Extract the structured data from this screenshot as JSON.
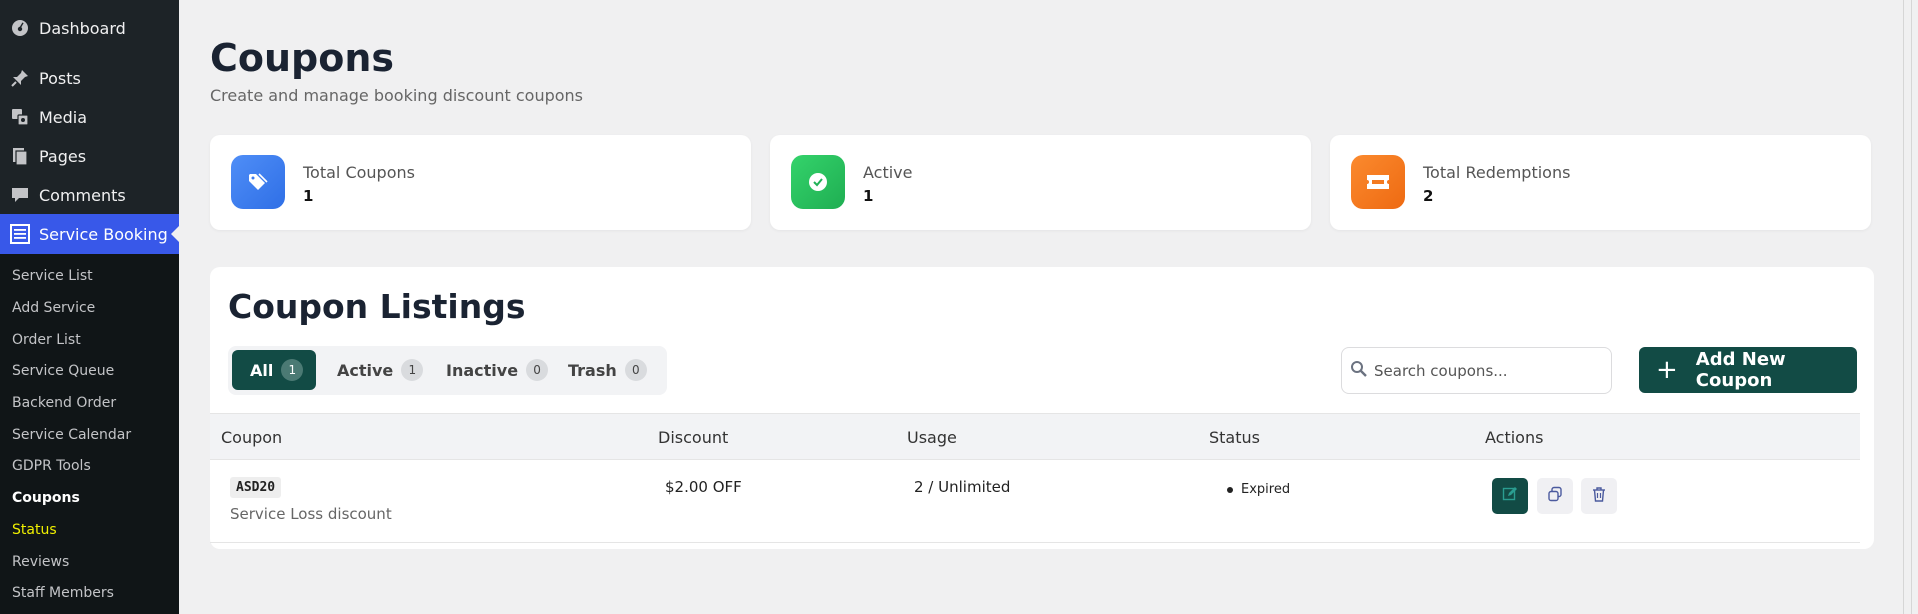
{
  "sidebar": {
    "top": [
      {
        "label": "Dashboard",
        "icon": "dashboard-icon"
      },
      {
        "label": "Posts",
        "icon": "pin-icon"
      },
      {
        "label": "Media",
        "icon": "media-icon"
      },
      {
        "label": "Pages",
        "icon": "pages-icon"
      },
      {
        "label": "Comments",
        "icon": "comment-icon"
      },
      {
        "label": "Service Booking",
        "icon": "list-icon"
      }
    ],
    "sub": [
      "Service List",
      "Add Service",
      "Order List",
      "Service Queue",
      "Backend Order",
      "Service Calendar",
      "GDPR Tools",
      "Coupons",
      "Status",
      "Reviews",
      "Staff Members"
    ]
  },
  "page": {
    "title": "Coupons",
    "subtitle": "Create and manage booking discount coupons"
  },
  "stats": [
    {
      "label": "Total Coupons",
      "value": "1",
      "color": "#3b82f6",
      "icon": "tag-icon"
    },
    {
      "label": "Active",
      "value": "1",
      "color": "#22c55e",
      "icon": "check-circle-icon"
    },
    {
      "label": "Total Redemptions",
      "value": "2",
      "color": "#f97316",
      "icon": "ticket-icon"
    }
  ],
  "listing": {
    "title": "Coupon Listings",
    "tabs": [
      {
        "label": "All",
        "count": "1"
      },
      {
        "label": "Active",
        "count": "1"
      },
      {
        "label": "Inactive",
        "count": "0"
      },
      {
        "label": "Trash",
        "count": "0"
      }
    ],
    "search_placeholder": "Search coupons...",
    "add_label": "Add New Coupon",
    "add_symbol": "+",
    "columns": [
      "Coupon",
      "Discount",
      "Usage",
      "Status",
      "Actions"
    ],
    "rows": [
      {
        "code": "ASD20",
        "description": "Service Loss discount",
        "discount": "$2.00 OFF",
        "usage": "2 / Unlimited",
        "status": "Expired"
      }
    ]
  },
  "colors": {
    "accent": "#124b45",
    "sidebar": "#1d2327",
    "sidebar_active": "#3858e9"
  }
}
